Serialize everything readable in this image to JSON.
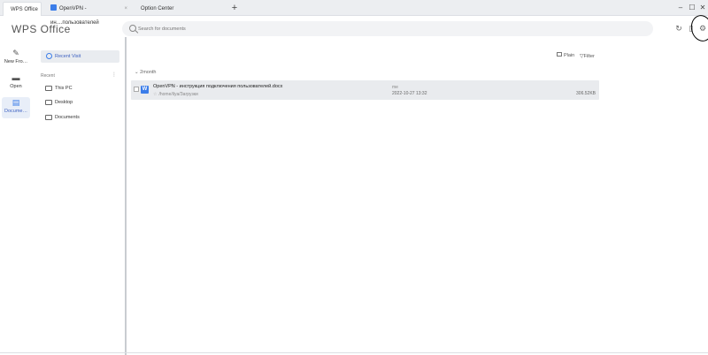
{
  "tabs": [
    {
      "label": "WPS Office",
      "active": true
    },
    {
      "label": "OpenVPN - ин....пользователей",
      "close": "×",
      "active": false
    },
    {
      "label": "Option Center",
      "active": false
    }
  ],
  "new_tab": "+",
  "window_controls": {
    "minimize": "–",
    "maximize": "☐",
    "close": "✕"
  },
  "logo": "WPS Office",
  "search": {
    "placeholder": "Search for documents"
  },
  "left_nav": [
    {
      "label": "New Fro…",
      "icon": "new-file-icon"
    },
    {
      "label": "Open",
      "icon": "folder-icon"
    },
    {
      "label": "Docume…",
      "icon": "document-icon",
      "active": true
    }
  ],
  "sidebar": {
    "recent_visit": "Recent Visit",
    "section_label": "Recent",
    "more": "⋮",
    "items": [
      {
        "label": "This PC",
        "icon": "computer-icon"
      },
      {
        "label": "Desktop",
        "icon": "desktop-folder-icon"
      },
      {
        "label": "Documents",
        "icon": "documents-folder-icon"
      }
    ]
  },
  "toolbar": {
    "plain": "Plain",
    "filter": "Filter"
  },
  "group_label": "2month",
  "files": [
    {
      "name": "OpenVPN - инструкция подключения пользователей.docx",
      "path": "/home/ilya/Загрузки",
      "owner": "me",
      "date": "2022-10-27 13:32",
      "size": "306.52KB"
    }
  ],
  "accent_color": "#3b7de9"
}
